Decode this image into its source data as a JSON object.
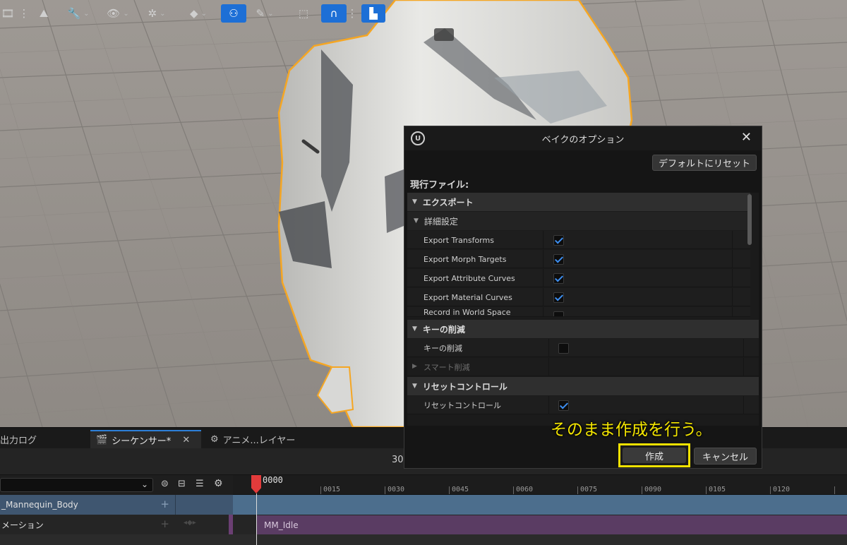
{
  "tabs": [
    {
      "label": "出力ログ",
      "active": false
    },
    {
      "label": "シーケンサー*",
      "active": true
    },
    {
      "label": "アニメ...レイヤー",
      "active": false
    }
  ],
  "toolbar": {
    "frame_rate": "30"
  },
  "timeline": {
    "current_frame": "0000",
    "ticks": [
      "0015",
      "0030",
      "0045",
      "0060",
      "0075",
      "0090",
      "0105",
      "0120"
    ]
  },
  "tracks": [
    {
      "label": "_Mannequin_Body",
      "type": "actor"
    },
    {
      "label": "メーション",
      "type": "animation",
      "section": "MM_Idle"
    }
  ],
  "dialog": {
    "title": "ベイクのオプション",
    "reset_label": "デフォルトにリセット",
    "current_file_label": "現行ファイル:",
    "categories": {
      "export": "エクスポート",
      "advanced": "詳細設定",
      "key_reduction": "キーの削減",
      "reset_controls": "リセットコントロール"
    },
    "export_props": [
      {
        "name": "Export Transforms",
        "checked": true
      },
      {
        "name": "Export Morph Targets",
        "checked": true
      },
      {
        "name": "Export Attribute Curves",
        "checked": true
      },
      {
        "name": "Export Material Curves",
        "checked": true
      },
      {
        "name": "Record in World Space",
        "checked": false
      }
    ],
    "key_reduction_prop": {
      "name": "キーの削減",
      "checked": false
    },
    "smart_reduce_label": "スマート削減",
    "reset_controls_prop": {
      "name": "リセットコントロール",
      "checked": true
    },
    "create_label": "作成",
    "cancel_label": "キャンセル"
  },
  "caption": "そのまま作成を行う。",
  "colors": {
    "accent": "#1d6fd6",
    "highlight": "#f2e200",
    "selection_outline": "#f5a623",
    "playhead": "#e23b3b"
  }
}
